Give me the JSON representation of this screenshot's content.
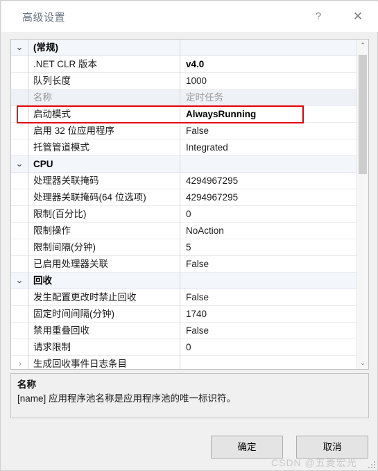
{
  "window": {
    "title": "高级设置",
    "help_icon": "question-mark-icon",
    "close_icon": "close-icon"
  },
  "grid": {
    "groups": [
      {
        "label": "(常规)",
        "expander": "chevron-down-icon",
        "expanded": true,
        "rows": [
          {
            "label": ".NET CLR 版本",
            "value": "v4.0",
            "value_style": "bold",
            "label_style": "normal",
            "selected": false,
            "highlighted": false
          },
          {
            "label": "队列长度",
            "value": "1000",
            "value_style": "normal",
            "label_style": "normal",
            "selected": false,
            "highlighted": false
          },
          {
            "label": "名称",
            "value": "定时任务",
            "value_style": "dim",
            "label_style": "dim",
            "selected": true,
            "highlighted": false
          },
          {
            "label": "启动模式",
            "value": "AlwaysRunning",
            "value_style": "bold",
            "label_style": "normal",
            "selected": false,
            "highlighted": true
          },
          {
            "label": "启用 32 位应用程序",
            "value": "False",
            "value_style": "normal",
            "label_style": "normal",
            "selected": false,
            "highlighted": false
          },
          {
            "label": "托管管道模式",
            "value": "Integrated",
            "value_style": "normal",
            "label_style": "normal",
            "selected": false,
            "highlighted": false
          }
        ]
      },
      {
        "label": "CPU",
        "expander": "chevron-down-icon",
        "expanded": true,
        "rows": [
          {
            "label": "处理器关联掩码",
            "value": "4294967295",
            "value_style": "normal",
            "label_style": "normal",
            "selected": false,
            "highlighted": false
          },
          {
            "label": "处理器关联掩码(64 位选项)",
            "value": "4294967295",
            "value_style": "normal",
            "label_style": "normal",
            "selected": false,
            "highlighted": false
          },
          {
            "label": "限制(百分比)",
            "value": "0",
            "value_style": "normal",
            "label_style": "normal",
            "selected": false,
            "highlighted": false
          },
          {
            "label": "限制操作",
            "value": "NoAction",
            "value_style": "normal",
            "label_style": "normal",
            "selected": false,
            "highlighted": false
          },
          {
            "label": "限制间隔(分钟)",
            "value": "5",
            "value_style": "normal",
            "label_style": "normal",
            "selected": false,
            "highlighted": false
          },
          {
            "label": "已启用处理器关联",
            "value": "False",
            "value_style": "normal",
            "label_style": "normal",
            "selected": false,
            "highlighted": false
          }
        ]
      },
      {
        "label": "回收",
        "expander": "chevron-down-icon",
        "expanded": true,
        "rows": [
          {
            "label": "发生配置更改时禁止回收",
            "value": "False",
            "value_style": "normal",
            "label_style": "normal",
            "selected": false,
            "highlighted": false
          },
          {
            "label": "固定时间间隔(分钟)",
            "value": "1740",
            "value_style": "normal",
            "label_style": "normal",
            "selected": false,
            "highlighted": false
          },
          {
            "label": "禁用重叠回收",
            "value": "False",
            "value_style": "normal",
            "label_style": "normal",
            "selected": false,
            "highlighted": false
          },
          {
            "label": "请求限制",
            "value": "0",
            "value_style": "normal",
            "label_style": "normal",
            "selected": false,
            "highlighted": false
          },
          {
            "label": "生成回收事件日志条目",
            "value": "",
            "value_style": "normal",
            "label_style": "normal",
            "selected": false,
            "highlighted": false,
            "expander": "chevron-right-icon"
          }
        ]
      }
    ],
    "scrollbar": {
      "up_icon": "chevron-up-icon",
      "down_icon": "chevron-down-icon"
    }
  },
  "description": {
    "title": "名称",
    "text": "[name] 应用程序池名称是应用程序池的唯一标识符。"
  },
  "footer": {
    "ok_label": "确定",
    "cancel_label": "取消"
  },
  "watermark": "CSDN @五菱宏光",
  "colors": {
    "highlight": "#e40000",
    "title_text": "#6a7480",
    "group_header_bg": "#f3f6fa",
    "selected_row_bg": "#eef1f5",
    "button_bg": "#e4e4e4"
  }
}
